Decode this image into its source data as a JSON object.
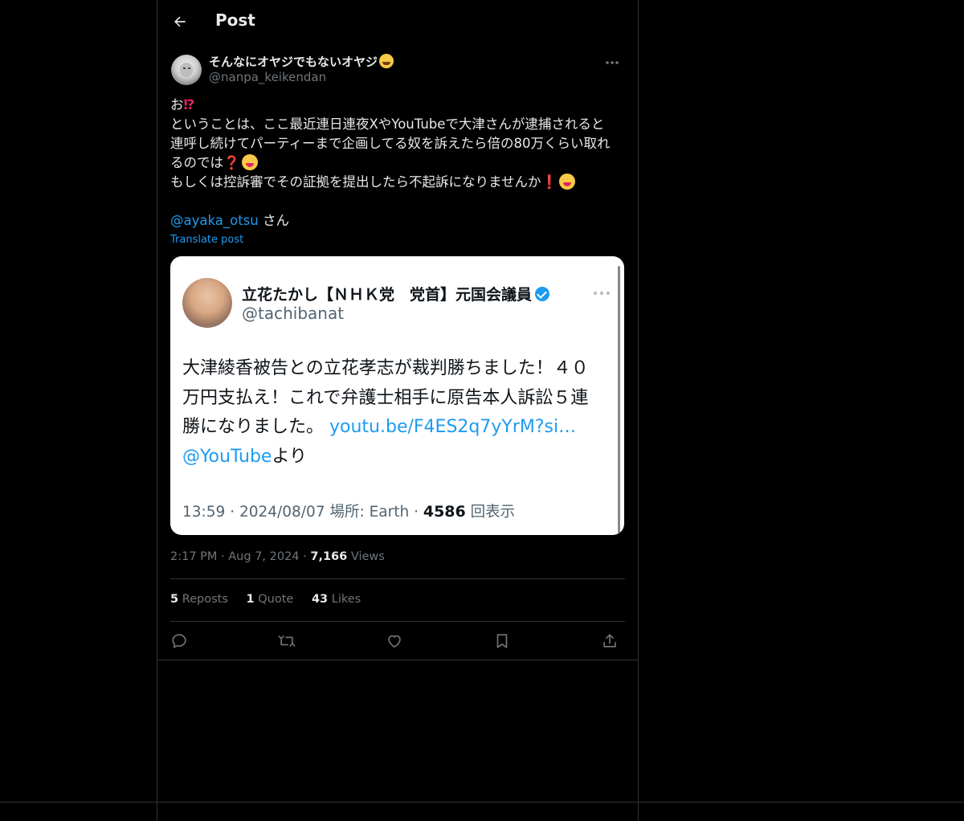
{
  "header": {
    "title": "Post"
  },
  "author": {
    "name": "そんなにオヤジでもないオヤジ",
    "handle": "@nanpa_keikendan"
  },
  "post": {
    "line1": "お",
    "line2": "ということは、ここ最近連日連夜XやYouTubeで大津さんが逮捕されると",
    "line3": "連呼し続けてパーティーまで企画してる奴を訴えたら倍の80万くらい取れ",
    "line4": "るのでは",
    "line5": "もしくは控訴審でその証拠を提出したら不起訴になりませんか",
    "mention": "@ayaka_otsu",
    "mention_suffix": " さん",
    "translate": "Translate post"
  },
  "embed": {
    "name": "立花たかし【ＮＨＫ党　党首】元国会議員",
    "handle": "@tachibanat",
    "line1": "大津綾香被告との立花孝志が裁判勝ちました！４０",
    "line2": "万円支払え！これで弁護士相手に原告本人訴訟５連",
    "line3a": "勝になりました。 ",
    "line3_link": "youtu.be/F4ES2q7yYrM?si…",
    "line4_link": "@YouTube",
    "line4b": "より",
    "meta_prefix": "13:59 · 2024/08/07  場所: Earth · ",
    "meta_count": "4586",
    "meta_suffix": " 回表示"
  },
  "meta": {
    "time": "2:17 PM",
    "sep1": " · ",
    "date": "Aug 7, 2024",
    "sep2": " · ",
    "views_count": "7,166",
    "views_label": " Views"
  },
  "stats": {
    "reposts_count": "5",
    "reposts_label": " Reposts",
    "quotes_count": "1",
    "quotes_label": " Quote",
    "likes_count": "43",
    "likes_label": " Likes"
  },
  "icons": {
    "back": "arrow-left-icon",
    "more": "more-horizontal-icon",
    "reply": "reply-icon",
    "repost": "repost-icon",
    "like": "heart-icon",
    "bookmark": "bookmark-icon",
    "share": "share-icon"
  },
  "colors": {
    "background": "#000000",
    "accent": "#1d9bf0",
    "text": "#e7e9ea",
    "muted": "#71767b",
    "border": "#2f3336"
  }
}
